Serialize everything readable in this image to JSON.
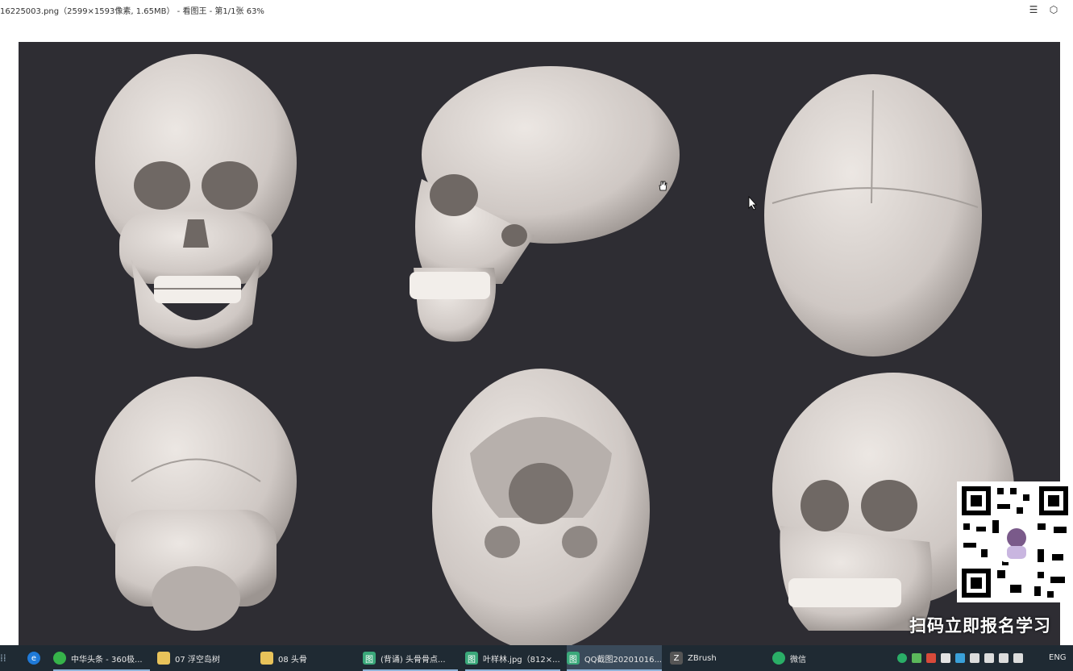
{
  "window": {
    "title": "16225003.png（2599×1593像素, 1.65MB） - 看图王 - 第1/1张 63%"
  },
  "overlay": {
    "qr_caption": "扫码立即报名学习"
  },
  "taskbar": {
    "items": [
      {
        "label": "中华头条 - 360极..."
      },
      {
        "label": "07 浮空岛树"
      },
      {
        "label": "08 头骨"
      },
      {
        "label": "(背诵) 头骨骨点..."
      },
      {
        "label": "叶样林.jpg（812×..."
      },
      {
        "label": "QQ截图20201016..."
      },
      {
        "label": "ZBrush"
      },
      {
        "label": "微信"
      }
    ],
    "language": "ENG"
  },
  "colors": {
    "image_background": "#2e2d33",
    "skull": "#d9d3cf",
    "taskbar": "#1f2a33"
  }
}
